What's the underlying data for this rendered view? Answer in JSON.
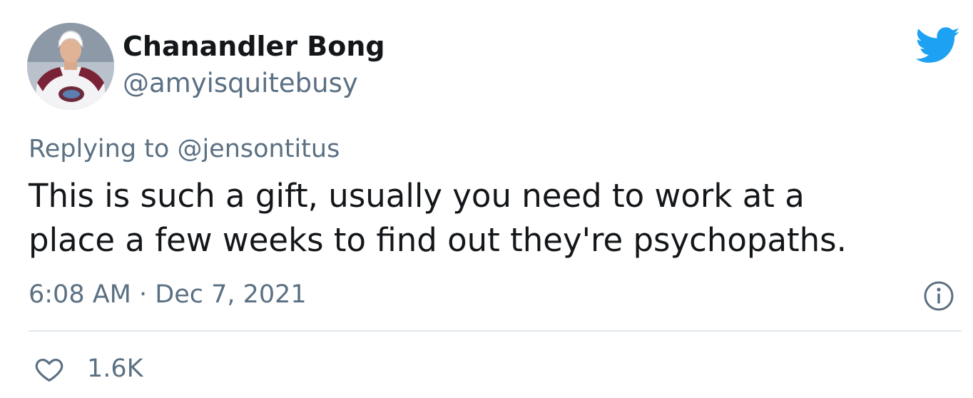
{
  "tweet": {
    "author": {
      "display_name": "Chanandler Bong",
      "handle": "@amyisquitebusy",
      "avatar_icon": "avatar-hockey-player"
    },
    "reply_to": "Replying to @jensontitus",
    "text_lines": [
      "This is such a gift, usually you need to work at a",
      "place a few weeks to find out they're psychopaths."
    ],
    "timestamp": "6:08 AM · Dec 7, 2021",
    "likes": "1.6K",
    "icons": {
      "brand": "twitter-bird-icon",
      "info": "info-icon",
      "like": "heart-outline-icon"
    },
    "colors": {
      "brand_blue": "#1da1f2",
      "text_primary": "#14171a",
      "text_secondary": "#5b7083",
      "divider": "#e1e8ed"
    }
  }
}
